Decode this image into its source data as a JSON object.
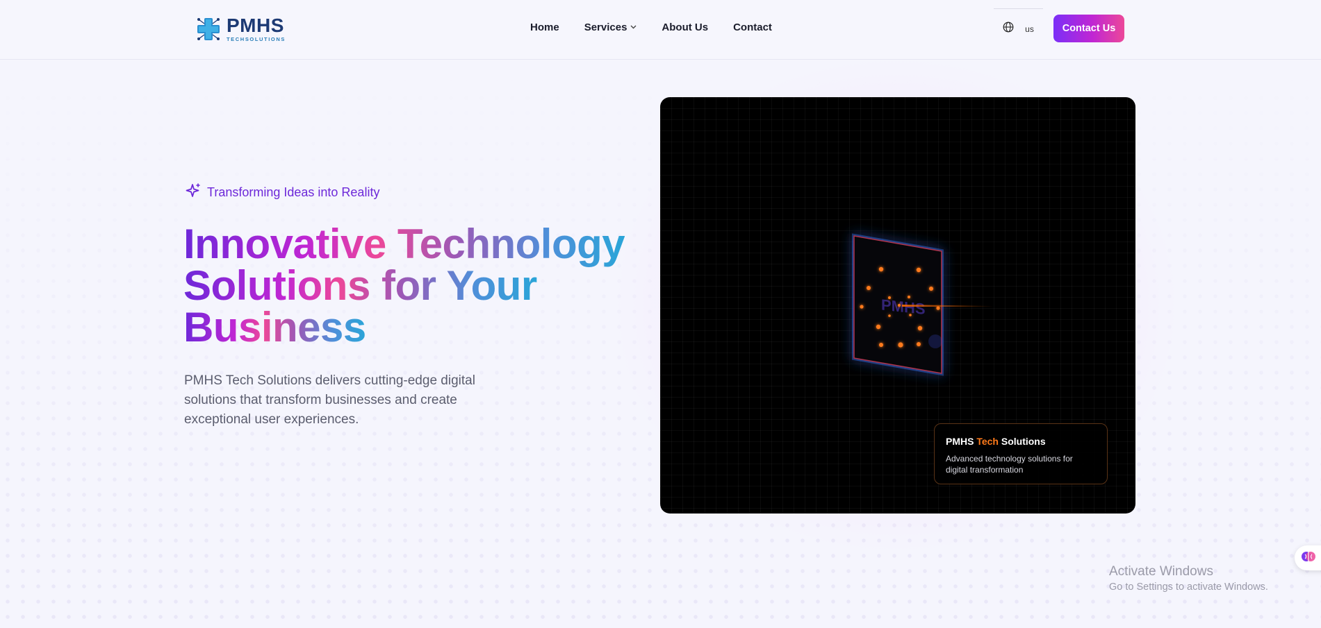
{
  "brand": {
    "name": "PMHS",
    "tagline": "TECHSOLUTIONS"
  },
  "nav": {
    "items": [
      {
        "label": "Home"
      },
      {
        "label": "Services",
        "has_dropdown": true
      },
      {
        "label": "About Us"
      },
      {
        "label": "Contact"
      }
    ],
    "language_code": "us",
    "cta_label": "Contact Us"
  },
  "hero": {
    "badge": "Transforming Ideas into Reality",
    "headline_line1": "Innovative Technology",
    "headline_line2": "Solutions for Your",
    "headline_line3": "Business",
    "description": "PMHS Tech Solutions delivers cutting-edge digital solutions that transform businesses and create exceptional user experiences."
  },
  "visual": {
    "screen_text": "PMHS",
    "card_title_part1": "PMHS ",
    "card_title_accent": "Tech",
    "card_title_part2": " Solutions",
    "card_description": "Advanced technology solutions for digital transformation"
  },
  "watermark": {
    "title": "Activate Windows",
    "subtitle": "Go to Settings to activate Windows."
  },
  "colors": {
    "brand_purple": "#7b2ff7",
    "brand_pink": "#ec4899",
    "accent_orange": "#ff7a1a",
    "logo_navy": "#1d3a74",
    "logo_blue": "#2a7fb8"
  },
  "icons": {
    "badge": "sparkles-icon",
    "language": "globe-icon",
    "dropdown": "chevron-down-icon",
    "widget": "brain-icon"
  }
}
